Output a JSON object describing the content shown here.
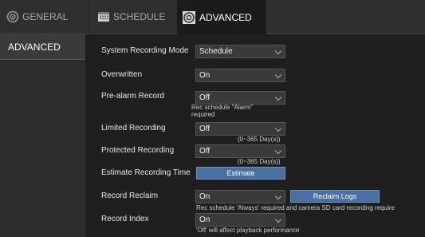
{
  "tabs": {
    "general": "GENERAL",
    "schedule": "SCHEDULE",
    "advanced": "ADVANCED"
  },
  "sidebar": {
    "items": [
      {
        "label": "ADVANCED"
      }
    ]
  },
  "rows": {
    "system_mode": {
      "label": "System Recording Mode",
      "value": "Schedule"
    },
    "overwritten": {
      "label": "Overwritten",
      "value": "On"
    },
    "pre_alarm": {
      "label": "Pre-alarm Record",
      "value": "Off",
      "note_line1": "Rec schedule \"Alarm\"",
      "note_line2": "required"
    },
    "limited": {
      "label": "Limited Recording",
      "value": "Off",
      "note": "(0~365 Day(s))"
    },
    "protected": {
      "label": "Protected Recording",
      "value": "Off",
      "note": "(0~365 Day(s))"
    },
    "estimate": {
      "label": "Estimate Recording Time",
      "button": "Estimate"
    },
    "reclaim": {
      "label": "Record Reclaim",
      "value": "On",
      "button": "Reclaim Logs",
      "note": "Rec schedule 'Always' required and camera SD card recording require"
    },
    "index": {
      "label": "Record Index",
      "value": "On",
      "note": "'Off' will affect playback performance"
    }
  },
  "colors": {
    "accent_button": "#4a6fa1",
    "background": "#1b1b1b",
    "panel": "#2c2c2c"
  },
  "icons": {
    "general": "gear-icon",
    "schedule": "calendar-icon",
    "advanced": "advanced-gear-icon"
  }
}
